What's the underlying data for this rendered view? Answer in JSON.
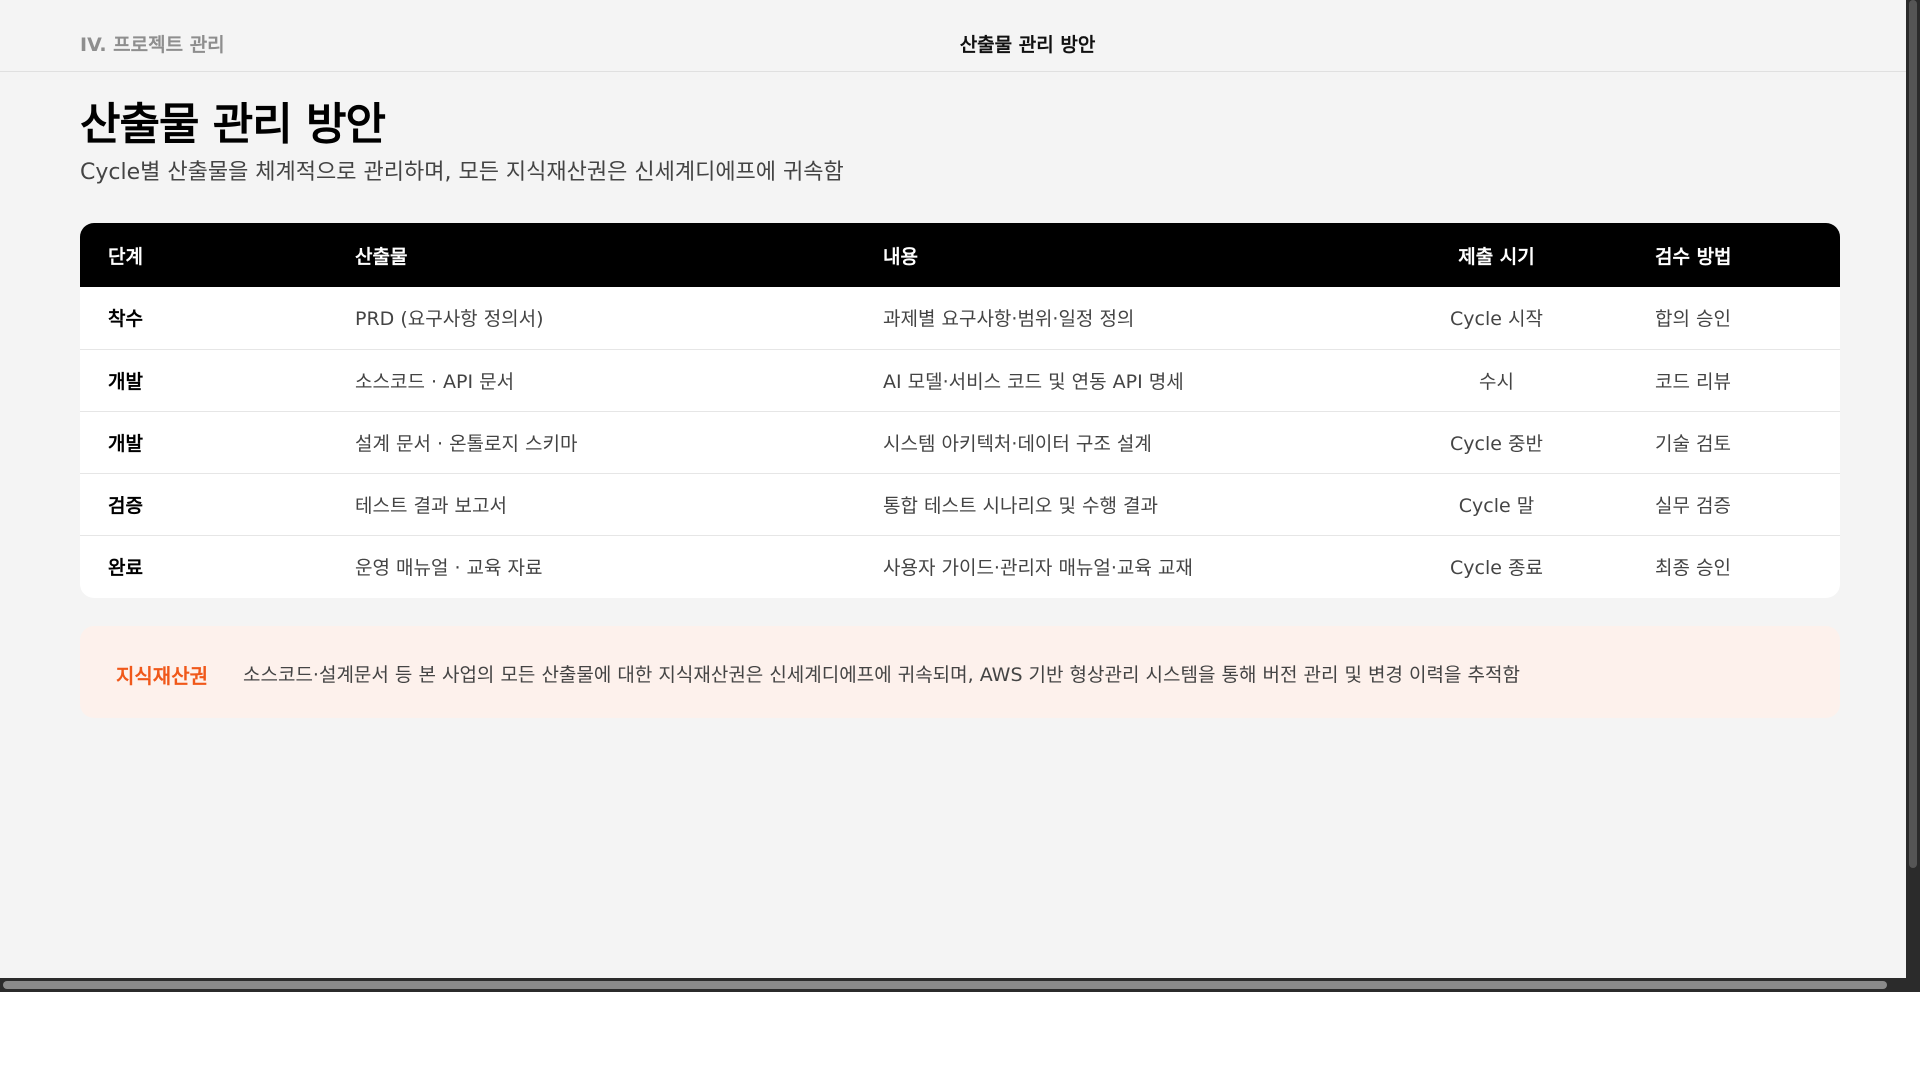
{
  "header": {
    "section": "IV. 프로젝트 관리",
    "title": "산출물 관리 방안"
  },
  "main": {
    "title": "산출물 관리 방안",
    "subtitle": "Cycle별 산출물을 체계적으로 관리하며, 모든 지식재산권은 신세계디에프에 귀속함"
  },
  "table": {
    "headers": [
      "단계",
      "산출물",
      "내용",
      "제출 시기",
      "검수 방법"
    ],
    "rows": [
      [
        "착수",
        "PRD (요구사항 정의서)",
        "과제별 요구사항·범위·일정 정의",
        "Cycle 시작",
        "합의 승인"
      ],
      [
        "개발",
        "소스코드 · API 문서",
        "AI 모델·서비스 코드 및 연동 API 명세",
        "수시",
        "코드 리뷰"
      ],
      [
        "개발",
        "설계 문서 · 온톨로지 스키마",
        "시스템 아키텍처·데이터 구조 설계",
        "Cycle 중반",
        "기술 검토"
      ],
      [
        "검증",
        "테스트 결과 보고서",
        "통합 테스트 시나리오 및 수행 결과",
        "Cycle 말",
        "실무 검증"
      ],
      [
        "완료",
        "운영 매뉴얼 · 교육 자료",
        "사용자 가이드·관리자 매뉴얼·교육 교재",
        "Cycle 종료",
        "최종 승인"
      ]
    ]
  },
  "notice": {
    "label": "지식재산권",
    "text": "소스코드·설계문서 등 본 사업의 모든 산출물에 대한 지식재산권은 신세계디에프에 귀속되며, AWS 기반 형상관리 시스템을 통해 버전 관리 및 변경 이력을 추적함"
  },
  "colors": {
    "background": "#f4f4f4",
    "header_row": "#000000",
    "accent": "#f0581a",
    "notice_bg": "#fdf1ec"
  }
}
